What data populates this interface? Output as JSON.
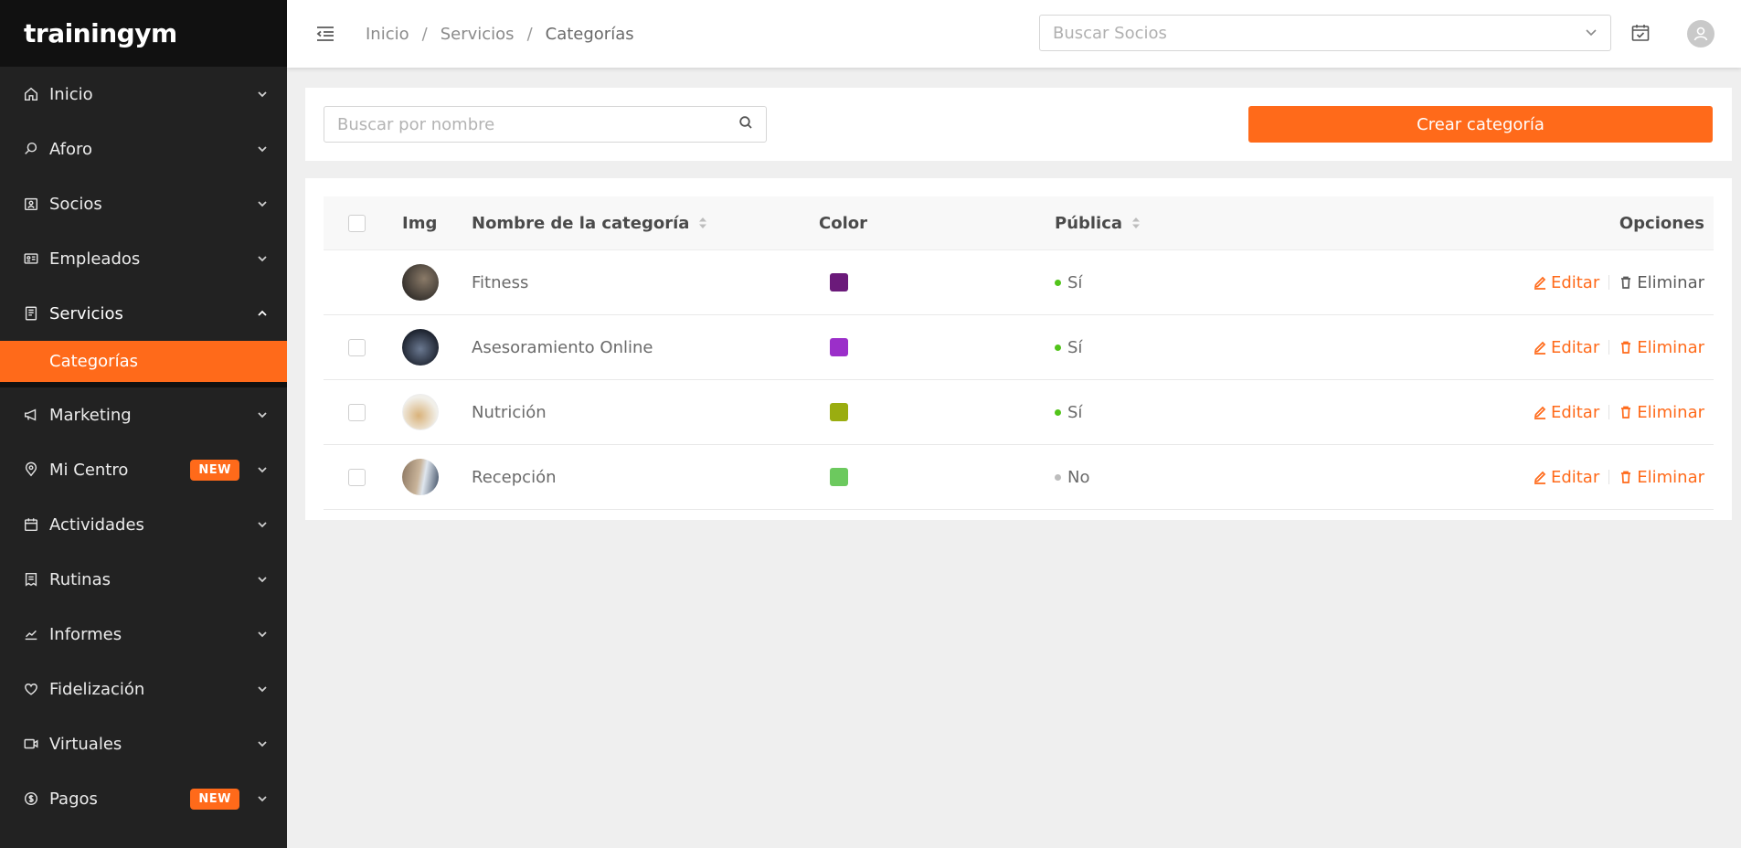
{
  "app": {
    "logo": "trainingym"
  },
  "sidebar": {
    "items": [
      {
        "label": "Inicio",
        "icon": "home-icon"
      },
      {
        "label": "Aforo",
        "icon": "search-icon"
      },
      {
        "label": "Socios",
        "icon": "members-icon"
      },
      {
        "label": "Empleados",
        "icon": "id-card-icon"
      },
      {
        "label": "Servicios",
        "icon": "receipt-icon",
        "expanded": true
      },
      {
        "label": "Marketing",
        "icon": "megaphone-icon"
      },
      {
        "label": "Mi Centro",
        "icon": "location-pin-icon",
        "badge": "NEW"
      },
      {
        "label": "Actividades",
        "icon": "calendar-icon"
      },
      {
        "label": "Rutinas",
        "icon": "clipboard-icon"
      },
      {
        "label": "Informes",
        "icon": "chart-line-icon"
      },
      {
        "label": "Fidelización",
        "icon": "heart-icon"
      },
      {
        "label": "Virtuales",
        "icon": "video-icon"
      },
      {
        "label": "Pagos",
        "icon": "coin-icon",
        "badge": "NEW"
      }
    ],
    "sub_active": "Categorías"
  },
  "header": {
    "breadcrumb": [
      "Inicio",
      "Servicios",
      "Categorías"
    ],
    "search_placeholder": "Buscar Socios"
  },
  "toolbar": {
    "search_placeholder": "Buscar por nombre",
    "create_label": "Crear categoría"
  },
  "table": {
    "columns": {
      "img": "Img",
      "name": "Nombre de la categoría",
      "color": "Color",
      "public": "Pública",
      "options": "Opciones"
    },
    "edit_label": "Editar",
    "delete_label": "Eliminar",
    "rows": [
      {
        "name": "Fitness",
        "color": "#6b1a7a",
        "public": "Sí",
        "public_color": "#52c41a",
        "has_checkbox": false,
        "thumb": [
          "#3a3530",
          "#8a7a68"
        ]
      },
      {
        "name": "Asesoramiento Online",
        "color": "#9b2fc9",
        "public": "Sí",
        "public_color": "#52c41a",
        "has_checkbox": true,
        "thumb": [
          "#1e2430",
          "#6a7890"
        ]
      },
      {
        "name": "Nutrición",
        "color": "#9aad10",
        "public": "Sí",
        "public_color": "#52c41a",
        "has_checkbox": true,
        "thumb": [
          "#f1efe9",
          "#d9b27a"
        ]
      },
      {
        "name": "Recepción",
        "color": "#6cc95e",
        "public": "No",
        "public_color": "#bdbdbd",
        "has_checkbox": true,
        "thumb": [
          "#8a7560",
          "#dfe6ee"
        ]
      }
    ]
  }
}
